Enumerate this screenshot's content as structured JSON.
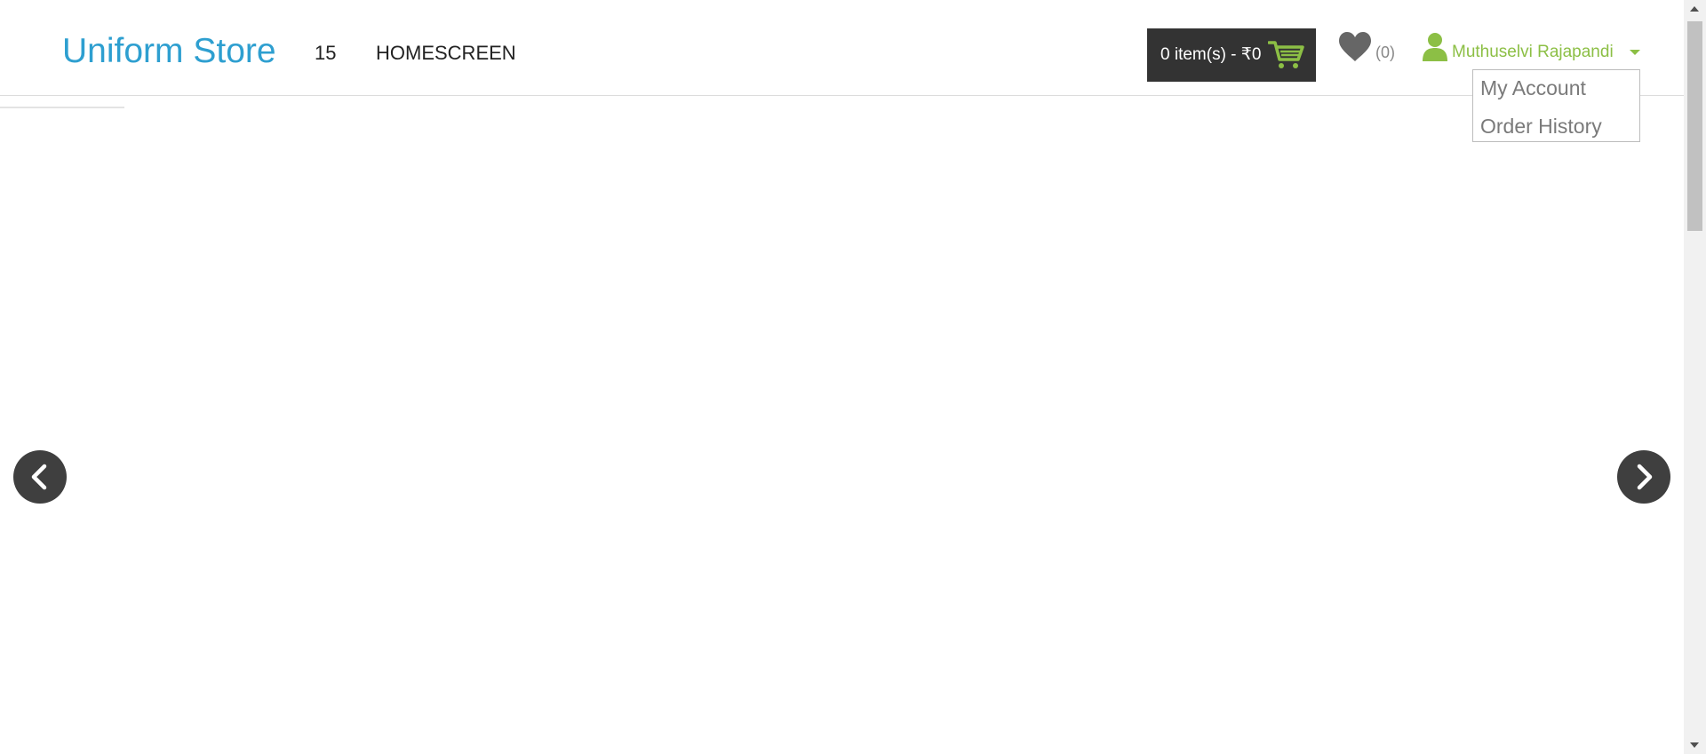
{
  "header": {
    "brand": "Uniform Store",
    "nav": {
      "number": "15",
      "home": "HOMESCREEN"
    },
    "cart": {
      "label": "0 item(s) - ₹0",
      "icon": "shopping-cart-icon"
    },
    "wishlist": {
      "icon": "heart-icon",
      "count": "(0)"
    },
    "user": {
      "icon": "user-icon",
      "name": "Muthuselvi Rajapandi",
      "dropdown": [
        "My Account",
        "Order History"
      ]
    }
  },
  "carousel": {
    "prev_icon": "chevron-left-icon",
    "next_icon": "chevron-right-icon"
  },
  "colors": {
    "brand": "#2e9fd0",
    "user_accent": "#8cbf45",
    "cart_bg": "#333333",
    "arrow_bg": "#3f3f3f"
  }
}
